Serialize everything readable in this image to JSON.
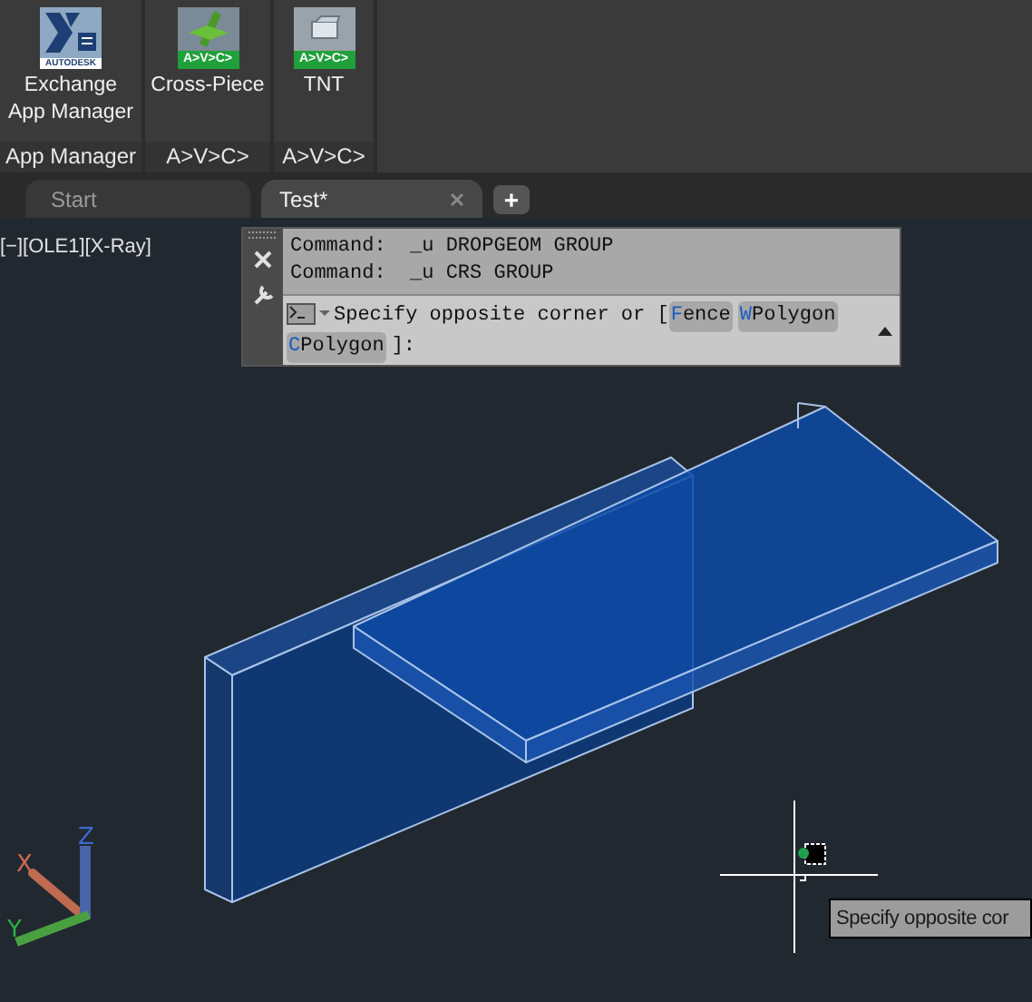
{
  "ribbon": {
    "panels": [
      {
        "title": "App Manager",
        "buttons": [
          {
            "label": "Exchange App Manager",
            "kind": "exchange",
            "badge": "AUTODESK"
          }
        ]
      },
      {
        "title": "A>V>C>",
        "buttons": [
          {
            "label": "Cross-Piece",
            "kind": "crosspiece",
            "badge": "A>V>C>"
          }
        ]
      },
      {
        "title": "A>V>C>",
        "buttons": [
          {
            "label": "TNT",
            "kind": "tnt",
            "badge": "A>V>C>"
          }
        ]
      }
    ]
  },
  "tabs": [
    {
      "label": "Start",
      "selected": false,
      "closable": false
    },
    {
      "label": "Test*",
      "selected": true,
      "closable": true
    }
  ],
  "new_tab": "+",
  "viewport": {
    "label": "[−][OLE1][X-Ray]",
    "axes": {
      "x": "X",
      "y": "Y",
      "z": "Z"
    },
    "tooltip": "Specify opposite cor"
  },
  "command_line": {
    "history": [
      "Command:  _u DROPGEOM GROUP",
      "Command:  _u CRS GROUP"
    ],
    "prompt": {
      "text": "Specify opposite corner or [",
      "options": [
        {
          "key": "F",
          "rest": "ence"
        },
        {
          "key": "W",
          "rest": "Polygon"
        },
        {
          "key": "C",
          "rest": "Polygon"
        }
      ],
      "end": "]:"
    }
  }
}
